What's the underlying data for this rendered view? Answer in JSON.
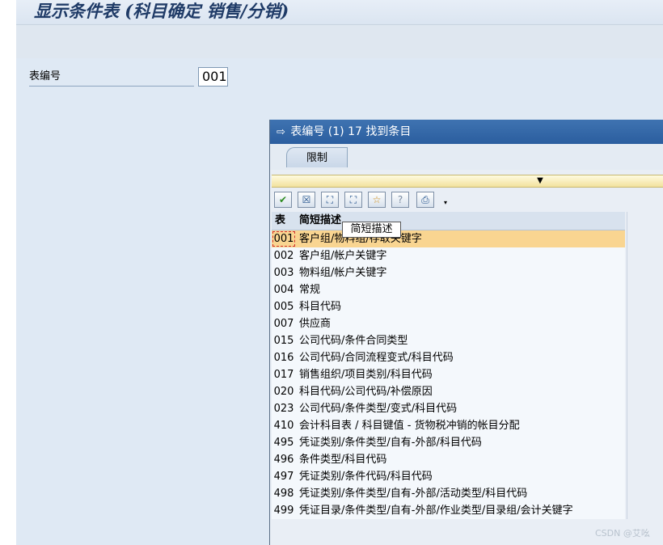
{
  "window": {
    "title": "显示条件表 (科目确定 销售/分销)"
  },
  "form": {
    "field_label": "表编号",
    "field_value": "001"
  },
  "popup": {
    "title_icon": "⇨",
    "title": "表编号 (1)   17 找到条目",
    "tab_label": "限制",
    "toolbar_icons": [
      "check-icon",
      "close-icon",
      "binoculars-icon",
      "binoculars-plus-icon",
      "star-icon",
      "help-icon",
      "print-icon"
    ],
    "toolbar_glyphs": [
      "✔",
      "☒",
      "⛶",
      "⛶",
      "☆",
      "?",
      "⎙"
    ],
    "columns": {
      "code": "表",
      "desc": "简短描述"
    },
    "tooltip": "简短描述",
    "rows": [
      {
        "code": "001",
        "desc": "客户组/物料组/存取关键字"
      },
      {
        "code": "002",
        "desc": "客户组/帐户关键字"
      },
      {
        "code": "003",
        "desc": "物料组/帐户关键字"
      },
      {
        "code": "004",
        "desc": "常规"
      },
      {
        "code": "005",
        "desc": "科目代码"
      },
      {
        "code": "007",
        "desc": "供应商"
      },
      {
        "code": "015",
        "desc": "公司代码/条件合同类型"
      },
      {
        "code": "016",
        "desc": "公司代码/合同流程变式/科目代码"
      },
      {
        "code": "017",
        "desc": "销售组织/项目类别/科目代码"
      },
      {
        "code": "020",
        "desc": "科目代码/公司代码/补偿原因"
      },
      {
        "code": "023",
        "desc": "公司代码/条件类型/变式/科目代码"
      },
      {
        "code": "410",
        "desc": "会计科目表 / 科目键值 - 货物税冲销的帐目分配"
      },
      {
        "code": "495",
        "desc": "凭证类别/条件类型/自有-外部/科目代码"
      },
      {
        "code": "496",
        "desc": "条件类型/科目代码"
      },
      {
        "code": "497",
        "desc": "凭证类别/条件代码/科目代码"
      },
      {
        "code": "498",
        "desc": "凭证类别/条件类型/自有-外部/活动类型/科目代码"
      },
      {
        "code": "499",
        "desc": "凭证目录/条件类型/自有-外部/作业类型/目录组/会计关键字"
      }
    ]
  },
  "watermark": "CSDN @艾吆"
}
